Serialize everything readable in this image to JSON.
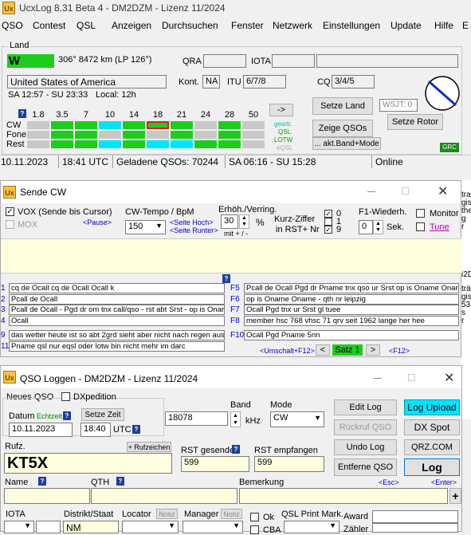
{
  "main": {
    "title": "UcxLog 8.31 Beta 4 - DM2DZM - Lizenz 11/2024",
    "menu": [
      "QSO",
      "Contest",
      "QSL",
      "Anzeigen",
      "Durchsuchen",
      "Fenster",
      "Netzwerk",
      "Einstellungen",
      "Update",
      "Hilfe",
      "E"
    ],
    "land": {
      "label": "Land",
      "prefix": "W",
      "bearing": "306°  8472 km   (LP 126°)",
      "qra_label": "QRA",
      "iota_label": "IOTA",
      "country": "United States of America",
      "kont_label": "Kont.",
      "kont": "NA",
      "itu_label": "ITU",
      "itu": "6/7/8",
      "cq_label": "CQ",
      "cq": "3/4/5",
      "sun": "SA 12:57 - SU 23:33",
      "local": "Local:  12h",
      "help": "?",
      "bands": [
        "1.8",
        "3.5",
        "7",
        "10",
        "14",
        "18",
        "21",
        "24",
        "28",
        "50"
      ],
      "modes": [
        "CW",
        "Fone",
        "Rest"
      ],
      "arrow_btn": "->",
      "legend": [
        "gearb.",
        "QSL",
        "LOTW",
        "eQSL"
      ],
      "setze_land": "Setze Land",
      "wsjt": "WSJT: 0",
      "setze_rotor": "Setze Rotor",
      "zeige_qsos": "Zeige QSOs",
      "akt_band": "... akt.Band+Mode",
      "grc": "GRC"
    },
    "status": {
      "date": "10.11.2023",
      "utc": "18:41 UTC",
      "loaded": "Geladene QSOs: 70244",
      "sun": "SA 06:16 - SU 15:28",
      "online": "Online"
    },
    "right_strip": [
      "tra",
      "gis",
      "the",
      "g",
      "r",
      "i2D",
      "",
      "trä",
      "gis",
      "53",
      "s",
      "r"
    ]
  },
  "cw": {
    "title": "Sende CW",
    "vox": "VOX (Sende bis Cursor)",
    "mox": "MOX",
    "pause": "<Pause>",
    "tempo_label": "CW-Tempo / BpM",
    "tempo": "150",
    "hoch": "<Seite Hoch>",
    "runter": "<Seite Runter>",
    "erh_label": "Erhöh./Verring.",
    "erh": "30",
    "percent": "%",
    "mitplus": "mit + / -",
    "kurz_label": "Kurz-Ziffer",
    "kurz_sub": "in RST+ Nr",
    "kurz_vals": [
      "0",
      "1",
      "9"
    ],
    "f1_label": "F1-Wiederh.",
    "f1": "0",
    "sek": "Sek.",
    "monitor": "Monitor",
    "tune": "Tune",
    "help": "?",
    "macros_left": [
      {
        "k": "1",
        "t": "cq de Ocall cq de Ocall Ocall k"
      },
      {
        "k": "2",
        "t": "Pcall de Ocall"
      },
      {
        "k": "3",
        "t": "Pcall de Ocall - Pgd dr om tnx call/qso - rst abt Srst - op is Onar"
      },
      {
        "k": "4",
        "t": "Ocall"
      },
      {
        "k": "9",
        "t": "das wetter heute ist so abt 2grd sieht aber nicht nach regen aus"
      },
      {
        "k": "11",
        "t": "Pname qsl nur eqsl oder lotw bin nicht mehr im darc"
      }
    ],
    "macros_right": [
      {
        "k": "F5",
        "t": "Pcall de Ocall Pgd dr Pname tnx qso ur Srst op  is Oname Onar"
      },
      {
        "k": "F6",
        "t": "op is Oname Oname - qth nr leipzig"
      },
      {
        "k": "F7",
        "t": "Ocall Pgd tnx ur Srst gl tuee"
      },
      {
        "k": "F8",
        "t": "member hsc 768 vhsc 71 qrv seit 1962 lange her hee"
      },
      {
        "k": "F10",
        "t": "Ocall Pgd Pname 5nn"
      }
    ],
    "umschalt": "<Umschalt+F12>",
    "lt": "<",
    "satz": "Satz 1",
    "gt": ">",
    "f12": "<F12>"
  },
  "qso": {
    "title": "QSO Loggen - DM2DZM - Lizenz 11/2024",
    "neues": "Neues QSO",
    "dxped": "DXpedition",
    "datum_label": "Datum",
    "echtzeit": "Echtzeit",
    "datum": "10.11.2023",
    "setze_zeit": "Setze Zeit",
    "zeit": "18:40",
    "utc": "UTC",
    "band_label": "Band",
    "band": "18078",
    "khz": "kHz",
    "mode_label": "Mode",
    "mode": "CW",
    "edit_log": "Edit Log",
    "log_upload": "Log Upload",
    "rueckruf": "Rückruf QSO",
    "dx_spot": "DX Spot",
    "undo_log": "Undo Log",
    "qrz": "QRZ.COM",
    "entferne": "Entferne QSO",
    "log": "Log",
    "rufz_label": "Rufz.",
    "rufzeichen_btn": "+ Rufzeichen",
    "rufz": "KT5X",
    "rst_g_label": "RST gesendet",
    "rst_g": "599",
    "rst_e_label": "RST empfangen",
    "rst_e": "599",
    "name_label": "Name",
    "qth_label": "QTH",
    "bemerkung_label": "Bemerkung",
    "esc": "<Esc>",
    "enter": "<Enter>",
    "plus": "+",
    "iota_label": "IOTA",
    "distrikt_label": "Distrikt/Staat",
    "distrikt": "NM",
    "locator_label": "Locator",
    "notiz1": "Notiz",
    "manager_label": "Manager",
    "notiz2": "Notiz",
    "ok": "Ok",
    "cba": "CBA",
    "qsl_print": "QSL Print Mark.",
    "award": "Award",
    "zaehler": "Zähler",
    "help": "?"
  },
  "colors": {
    "green": "#1ecc1e",
    "cyan": "#00e5ff",
    "accent_blue": "#0000cc",
    "grey": "#c8c8c8"
  },
  "cw_grid": {
    "CW": [
      "grey",
      "green",
      "green",
      "cyan",
      "green",
      "green-red",
      "green",
      "grey",
      "green",
      "grey"
    ],
    "Fone": [
      "grey",
      "green",
      "green",
      "grey",
      "green",
      "grey",
      "green",
      "grey",
      "green",
      "grey"
    ],
    "Rest": [
      "grey",
      "green",
      "green",
      "cyan",
      "green",
      "cyan",
      "cyan",
      "green",
      "green",
      "grey"
    ]
  }
}
